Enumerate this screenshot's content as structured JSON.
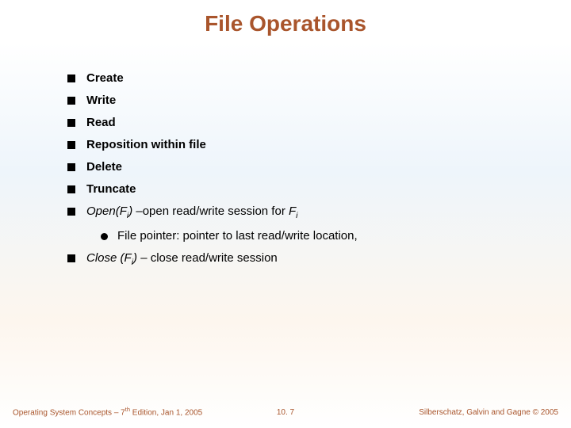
{
  "title": "File Operations",
  "items": {
    "create": "Create",
    "write": "Write",
    "read": "Read",
    "reposition": "Reposition within file",
    "delete": "Delete",
    "truncate": "Truncate",
    "open_pre": "Open(F",
    "open_sub": "i",
    "open_mid": ") –open read/write session for F",
    "open_sub2": "i",
    "sub_pointer": "File pointer:  pointer to last read/write location,",
    "close_pre": "Close (F",
    "close_sub": "i",
    "close_post": ") – close read/write session"
  },
  "footer": {
    "left_pre": "Operating System Concepts – 7",
    "left_sup": "th",
    "left_post": " Edition, Jan 1, 2005",
    "center": "10. 7",
    "right": "Silberschatz, Galvin and Gagne © 2005"
  }
}
